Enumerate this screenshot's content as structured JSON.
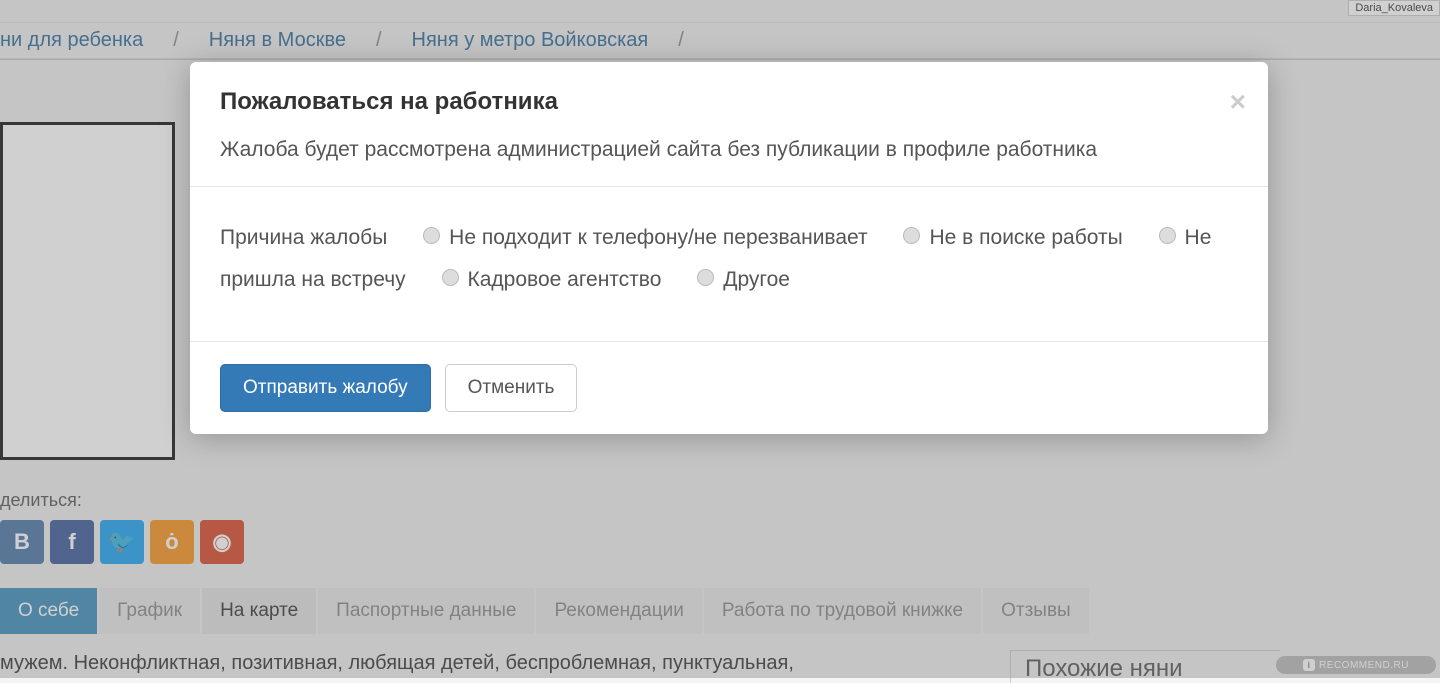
{
  "user_tag": "Daria_Kovaleva",
  "breadcrumbs": {
    "item1": "ни для ребенка",
    "item2": "Няня в Москве",
    "item3": "Няня у метро Войковская"
  },
  "share_label": "делиться:",
  "social": {
    "vk": "B",
    "fb": "f",
    "tw": "🐦",
    "ok1": "ȯ",
    "ok2": "◉"
  },
  "tabs": {
    "t1": "О себе",
    "t2": "График",
    "t3": "На карте",
    "t4": "Паспортные данные",
    "t5": "Рекомендации",
    "t6": "Работа по трудовой книжке",
    "t7": "Отзывы"
  },
  "bio_excerpt": "мужем. Неконфликтная, позитивная, любящая детей, беспроблемная, пунктуальная,",
  "sidebar_heading": "Похожие няни",
  "watermark": "RECOMMEND.RU",
  "modal": {
    "title": "Пожаловаться на работника",
    "subtitle": "Жалоба будет рассмотрена администрацией сайта без публикации в профиле работника",
    "reason_label": "Причина жалобы",
    "options": {
      "o1": "Не подходит к телефону/не перезванивает",
      "o2": "Не в поиске работы",
      "o3": "Не пришла на встречу",
      "o4": "Кадровое агентство",
      "o5": "Другое"
    },
    "submit": "Отправить жалобу",
    "cancel": "Отменить"
  }
}
